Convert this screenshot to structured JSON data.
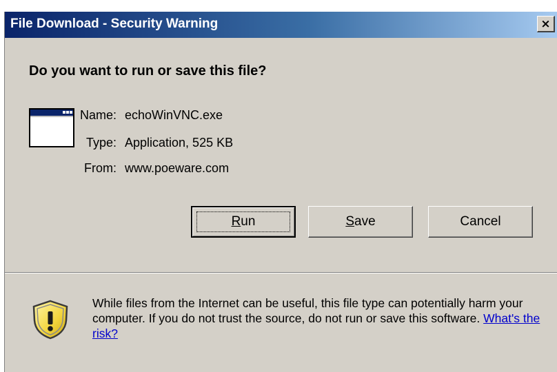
{
  "window": {
    "title": "File Download - Security Warning",
    "close_glyph": "×"
  },
  "question": "Do you want to run or save this file?",
  "fields": {
    "name_label": "Name:",
    "name_value": "echoWinVNC.exe",
    "type_label": "Type:",
    "type_value": "Application, 525 KB",
    "from_label": "From:",
    "from_value": "www.poeware.com"
  },
  "buttons": {
    "run_accel": "R",
    "run_rest": "un",
    "save_accel": "S",
    "save_rest": "ave",
    "cancel_label": "Cancel"
  },
  "warning": {
    "text": "While files from the Internet can be useful, this file type can potentially harm your computer. If you do not trust the source, do not run or save this software. ",
    "link_text": "What's the risk?"
  },
  "icons": {
    "app": "application-window-icon",
    "shield": "security-shield-warning-icon"
  },
  "colors": {
    "dialog_bg": "#d4d0c8",
    "title_start": "#0a246a",
    "title_end": "#a6caf0",
    "link": "#0000cc",
    "shield_yellow": "#f2d43c"
  }
}
